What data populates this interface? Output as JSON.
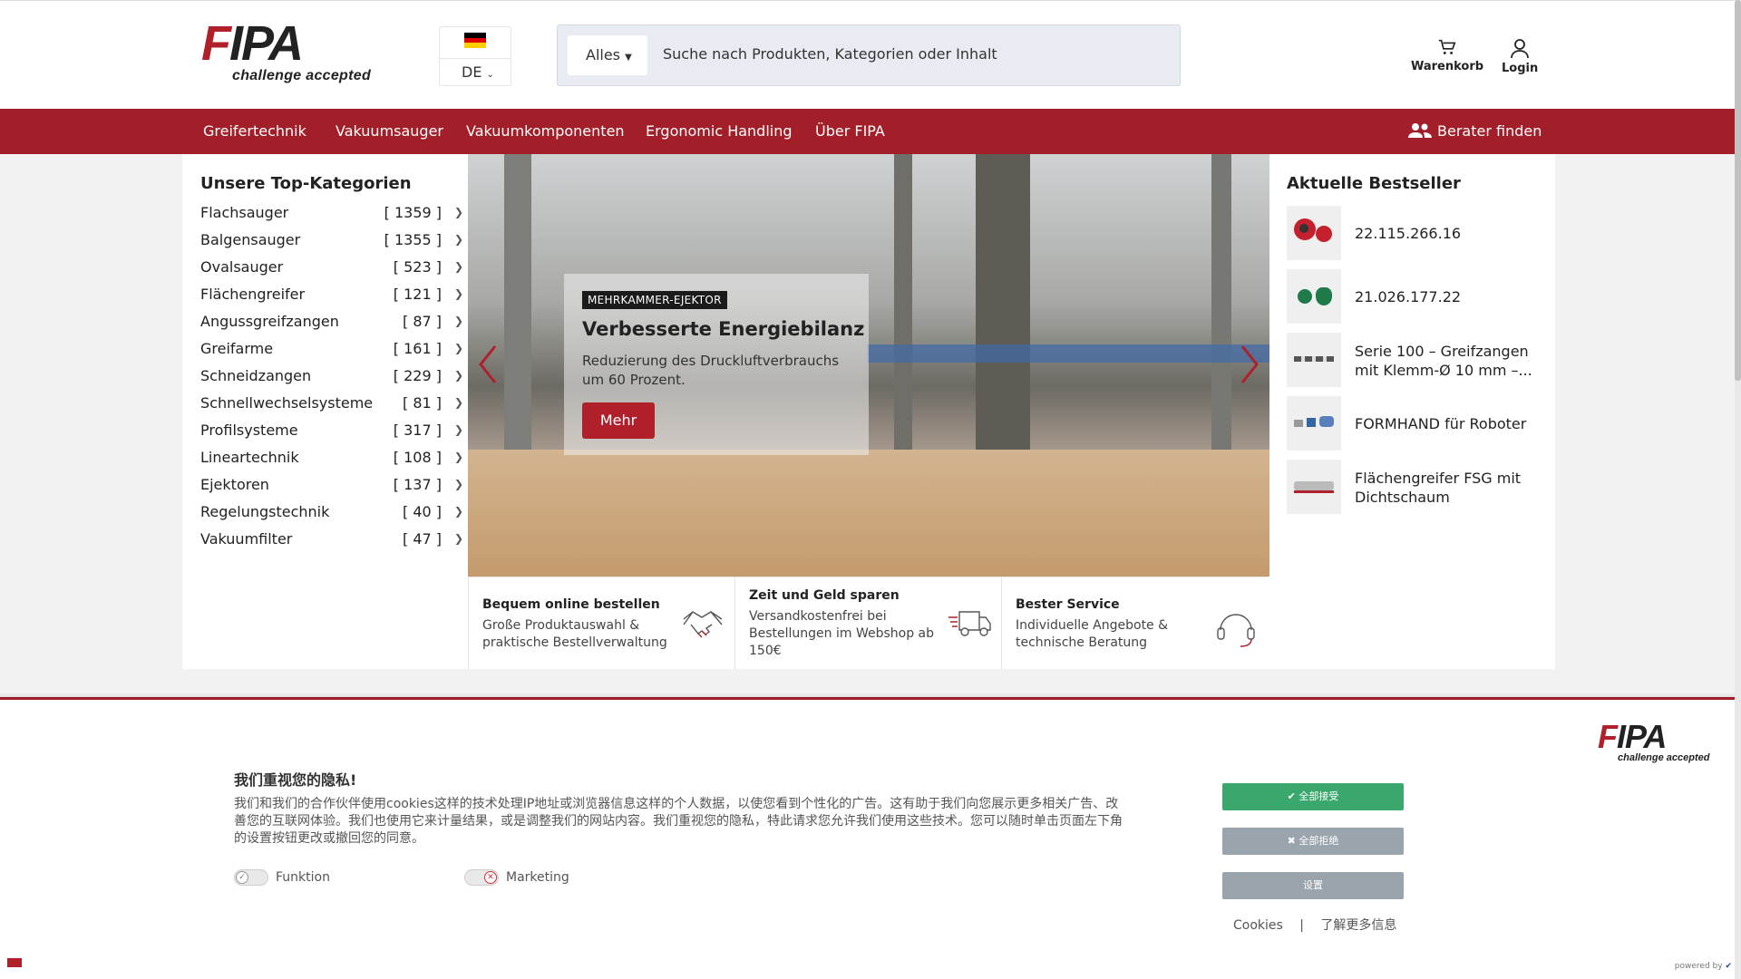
{
  "header": {
    "logo_text": "FIPA",
    "logo_tagline": "challenge accepted",
    "language_code": "DE",
    "search": {
      "scope": "Alles",
      "placeholder": "Suche nach Produkten, Kategorien oder Inhalt"
    },
    "cart_label": "Warenkorb",
    "login_label": "Login"
  },
  "nav": {
    "items": [
      "Greifertechnik",
      "Vakuumsauger",
      "Vakuumkomponenten",
      "Ergonomic Handling",
      "Über FIPA"
    ],
    "advisor_label": "Berater finden"
  },
  "categories": {
    "title": "Unsere Top-Kategorien",
    "items": [
      {
        "name": "Flachsauger",
        "count": "[ 1359 ]"
      },
      {
        "name": "Balgensauger",
        "count": "[ 1355 ]"
      },
      {
        "name": "Ovalsauger",
        "count": "[ 523 ]"
      },
      {
        "name": "Flächengreifer",
        "count": "[ 121 ]"
      },
      {
        "name": "Angussgreifzangen",
        "count": "[ 87 ]"
      },
      {
        "name": "Greifarme",
        "count": "[ 161 ]"
      },
      {
        "name": "Schneidzangen",
        "count": "[ 229 ]"
      },
      {
        "name": "Schnellwechselsysteme",
        "count": "[ 81 ]"
      },
      {
        "name": "Profilsysteme",
        "count": "[ 317 ]"
      },
      {
        "name": "Lineartechnik",
        "count": "[ 108 ]"
      },
      {
        "name": "Ejektoren",
        "count": "[ 137 ]"
      },
      {
        "name": "Regelungstechnik",
        "count": "[ 40 ]"
      },
      {
        "name": "Vakuumfilter",
        "count": "[ 47 ]"
      }
    ]
  },
  "hero": {
    "tag": "MEHRKAMMER-EJEKTOR",
    "title": "Verbesserte Energiebilanz",
    "subtitle": "Reduzierung des Druckluftverbrauchs um 60 Prozent.",
    "button": "Mehr"
  },
  "usps": [
    {
      "title": "Bequem online bestellen",
      "text": "Große Produktauswahl & praktische Bestellverwaltung",
      "icon": "handshake-icon"
    },
    {
      "title": "Zeit und Geld sparen",
      "text": "Versandkostenfrei bei Bestellungen im Webshop ab 150€",
      "icon": "truck-icon"
    },
    {
      "title": "Bester Service",
      "text": "Individuelle Angebote & technische Beratung",
      "icon": "headset-icon"
    }
  ],
  "bestsellers": {
    "title": "Aktuelle Bestseller",
    "items": [
      {
        "name": "22.115.266.16"
      },
      {
        "name": "21.026.177.22"
      },
      {
        "name": "Serie 100 – Greifzangen mit Klemm-Ø 10 mm –..."
      },
      {
        "name": "FORMHAND für Roboter"
      },
      {
        "name": "Flächengreifer FSG mit Dichtschaum"
      }
    ]
  },
  "cookie": {
    "title": "我们重视您的隐私!",
    "text": "我们和我们的合作伙伴使用cookies这样的技术处理IP地址或浏览器信息这样的个人数据，以使您看到个性化的广告。这有助于我们向您展示更多相关广告、改善您的互联网体验。我们也使用它来计量结果，或是调整我们的网站内容。我们重视您的隐私，特此请求您允许我们使用这些技术。您可以随时单击页面左下角的设置按钮更改或撤回您的同意。",
    "toggle_function": "Funktion",
    "toggle_marketing": "Marketing",
    "accept_all": "全部接受",
    "reject_all": "全部拒绝",
    "settings": "设置",
    "link_cookies": "Cookies",
    "link_separator": "|",
    "link_more": "了解更多信息",
    "powered_by": "powered by"
  },
  "colors": {
    "brand_red": "#a21f2a",
    "accept_green": "#3aa76d",
    "grey_button": "#9aa4ad"
  }
}
